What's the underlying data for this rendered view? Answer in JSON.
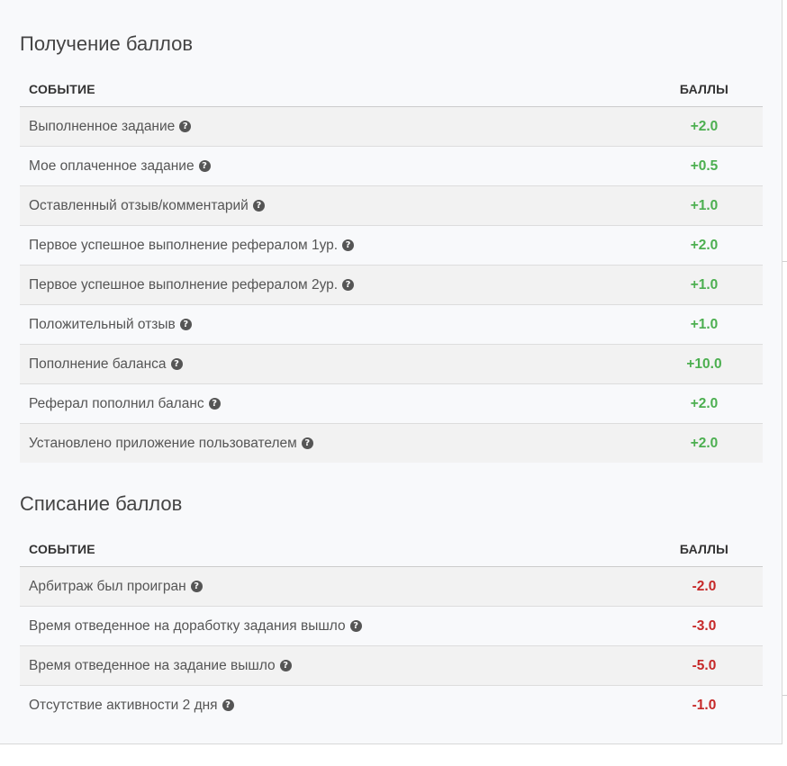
{
  "earn": {
    "title": "Получение баллов",
    "header_event": "СОБЫТИЕ",
    "header_points": "БАЛЛЫ",
    "rows": [
      {
        "event": "Выполненное задание",
        "points": "+2.0"
      },
      {
        "event": "Мое оплаченное задание",
        "points": "+0.5"
      },
      {
        "event": "Оставленный отзыв/комментарий",
        "points": "+1.0"
      },
      {
        "event": "Первое успешное выполнение рефералом 1ур.",
        "points": "+2.0"
      },
      {
        "event": "Первое успешное выполнение рефералом 2ур.",
        "points": "+1.0"
      },
      {
        "event": "Положительный отзыв",
        "points": "+1.0"
      },
      {
        "event": "Пополнение баланса",
        "points": "+10.0"
      },
      {
        "event": "Реферал пополнил баланс",
        "points": "+2.0"
      },
      {
        "event": "Установлено приложение пользователем",
        "points": "+2.0"
      }
    ]
  },
  "spend": {
    "title": "Списание баллов",
    "header_event": "СОБЫТИЕ",
    "header_points": "БАЛЛЫ",
    "rows": [
      {
        "event": "Арбитраж был проигран",
        "points": "-2.0"
      },
      {
        "event": "Время отведенное на доработку задания вышло",
        "points": "-3.0"
      },
      {
        "event": "Время отведенное на задание вышло",
        "points": "-5.0"
      },
      {
        "event": "Отсутствие активности 2 дня",
        "points": "-1.0"
      }
    ]
  },
  "icons": {
    "help": "question-circle-icon",
    "help_glyph": "?"
  },
  "colors": {
    "positive": "#4caf50",
    "negative": "#c62828"
  }
}
